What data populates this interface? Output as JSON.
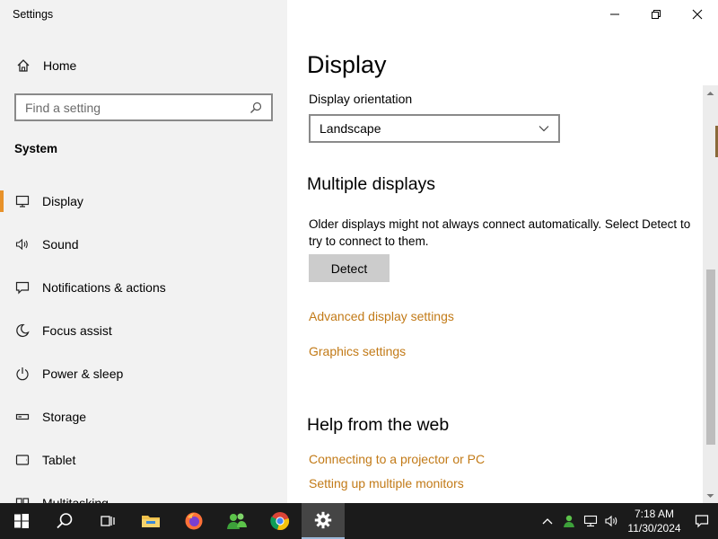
{
  "window": {
    "title": "Settings"
  },
  "sidebar": {
    "home_label": "Home",
    "search_placeholder": "Find a setting",
    "section_title": "System",
    "items": [
      {
        "label": "Display",
        "icon": "monitor-icon",
        "active": true
      },
      {
        "label": "Sound",
        "icon": "speaker-icon"
      },
      {
        "label": "Notifications & actions",
        "icon": "notification-icon"
      },
      {
        "label": "Focus assist",
        "icon": "moon-icon"
      },
      {
        "label": "Power & sleep",
        "icon": "power-icon"
      },
      {
        "label": "Storage",
        "icon": "storage-icon"
      },
      {
        "label": "Tablet",
        "icon": "tablet-icon"
      },
      {
        "label": "Multitasking",
        "icon": "multitasking-icon"
      }
    ]
  },
  "main": {
    "page_title": "Display",
    "orientation": {
      "label": "Display orientation",
      "value": "Landscape"
    },
    "multiple_displays": {
      "title": "Multiple displays",
      "description": "Older displays might not always connect automatically. Select Detect to try to connect to them.",
      "detect_label": "Detect"
    },
    "links": {
      "advanced": "Advanced display settings",
      "graphics": "Graphics settings"
    },
    "help": {
      "title": "Help from the web",
      "links": [
        "Connecting to a projector or PC",
        "Setting up multiple monitors"
      ]
    }
  },
  "taskbar": {
    "time": "7:18 AM",
    "date": "11/30/2024",
    "apps": [
      "start-icon",
      "search-icon",
      "task-view-icon",
      "file-explorer-icon",
      "firefox-icon",
      "people-icon",
      "chrome-icon",
      "settings-gear-icon"
    ]
  },
  "colors": {
    "accent": "#e8922a",
    "link": "#c27a17",
    "sidebar_bg": "#f2f2f2",
    "taskbar_bg": "#1b1b1b"
  }
}
